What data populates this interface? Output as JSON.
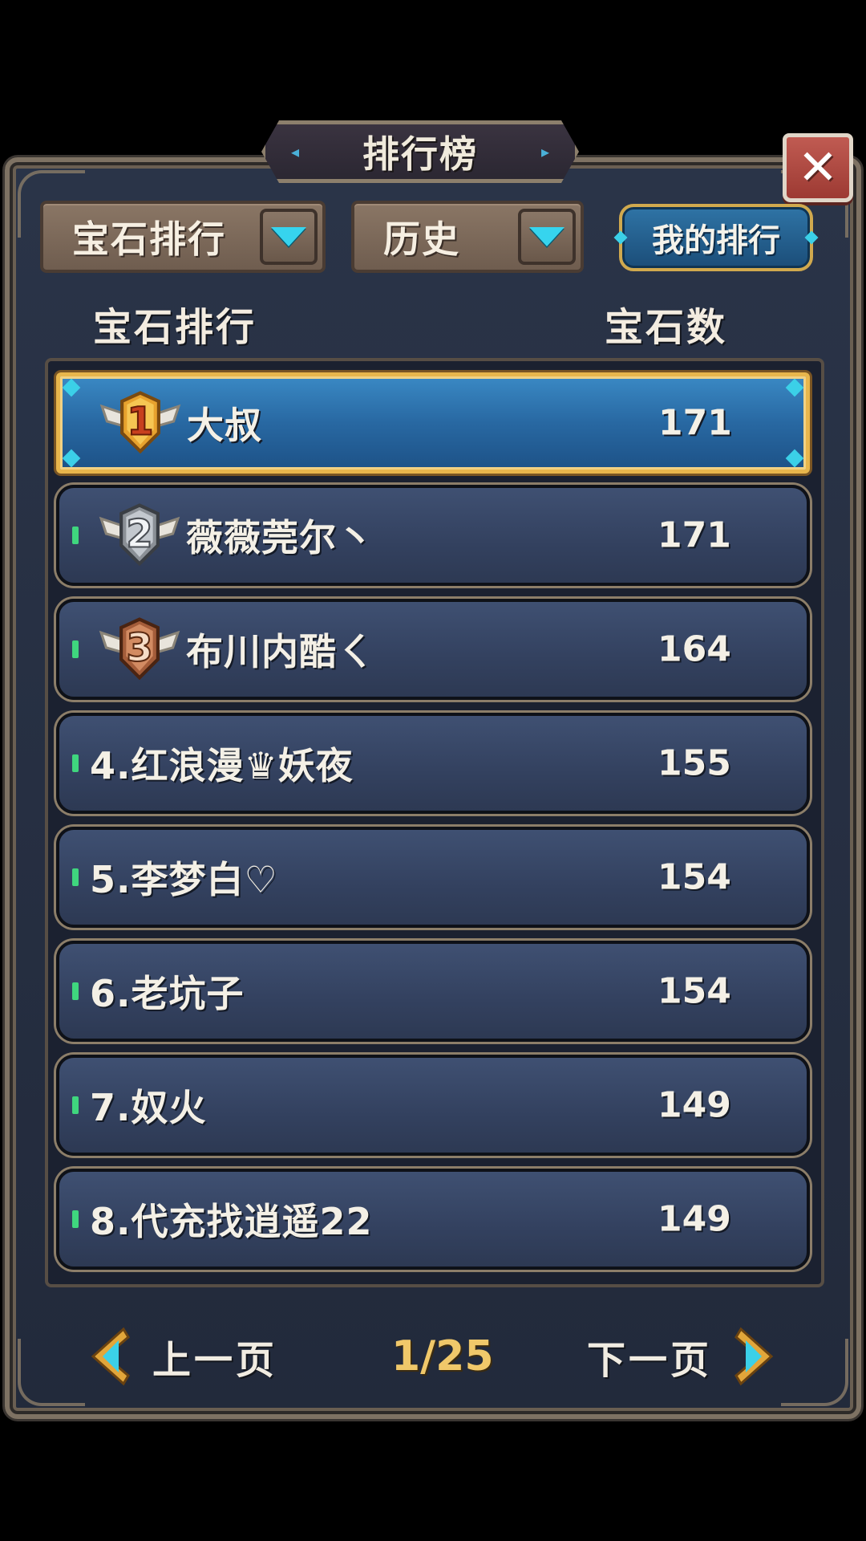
{
  "dialog": {
    "title": "排行榜",
    "close_icon": "close-icon",
    "accent": "#2868a2",
    "gold": "#e8b64c"
  },
  "filters": {
    "category": {
      "selected": "宝石排行"
    },
    "period": {
      "selected": "历史"
    },
    "my_rank_label": "我的排行"
  },
  "columns": {
    "left": "宝石排行",
    "right": "宝石数"
  },
  "rows": [
    {
      "rank": 1,
      "medal": "gold-rank-1-medal-icon",
      "name": "大叔",
      "score": "171"
    },
    {
      "rank": 2,
      "medal": "silver-rank-2-medal-icon",
      "name": "薇薇莞尔丶",
      "score": "171"
    },
    {
      "rank": 3,
      "medal": "bronze-rank-3-medal-icon",
      "name": "布川内酷ㄑ",
      "score": "164"
    },
    {
      "rank": 4,
      "name": "4.红浪漫♛妖夜",
      "score": "155"
    },
    {
      "rank": 5,
      "name": "5.李梦白♡",
      "score": "154"
    },
    {
      "rank": 6,
      "name": "6.老坑子",
      "score": "154"
    },
    {
      "rank": 7,
      "name": "7.奴火",
      "score": "149"
    },
    {
      "rank": 8,
      "name": "8.代充找逍遥22",
      "score": "149"
    }
  ],
  "pagination": {
    "prev_label": "上一页",
    "next_label": "下一页",
    "page_indicator": "1/25",
    "current_page": 1,
    "total_pages": 25
  }
}
